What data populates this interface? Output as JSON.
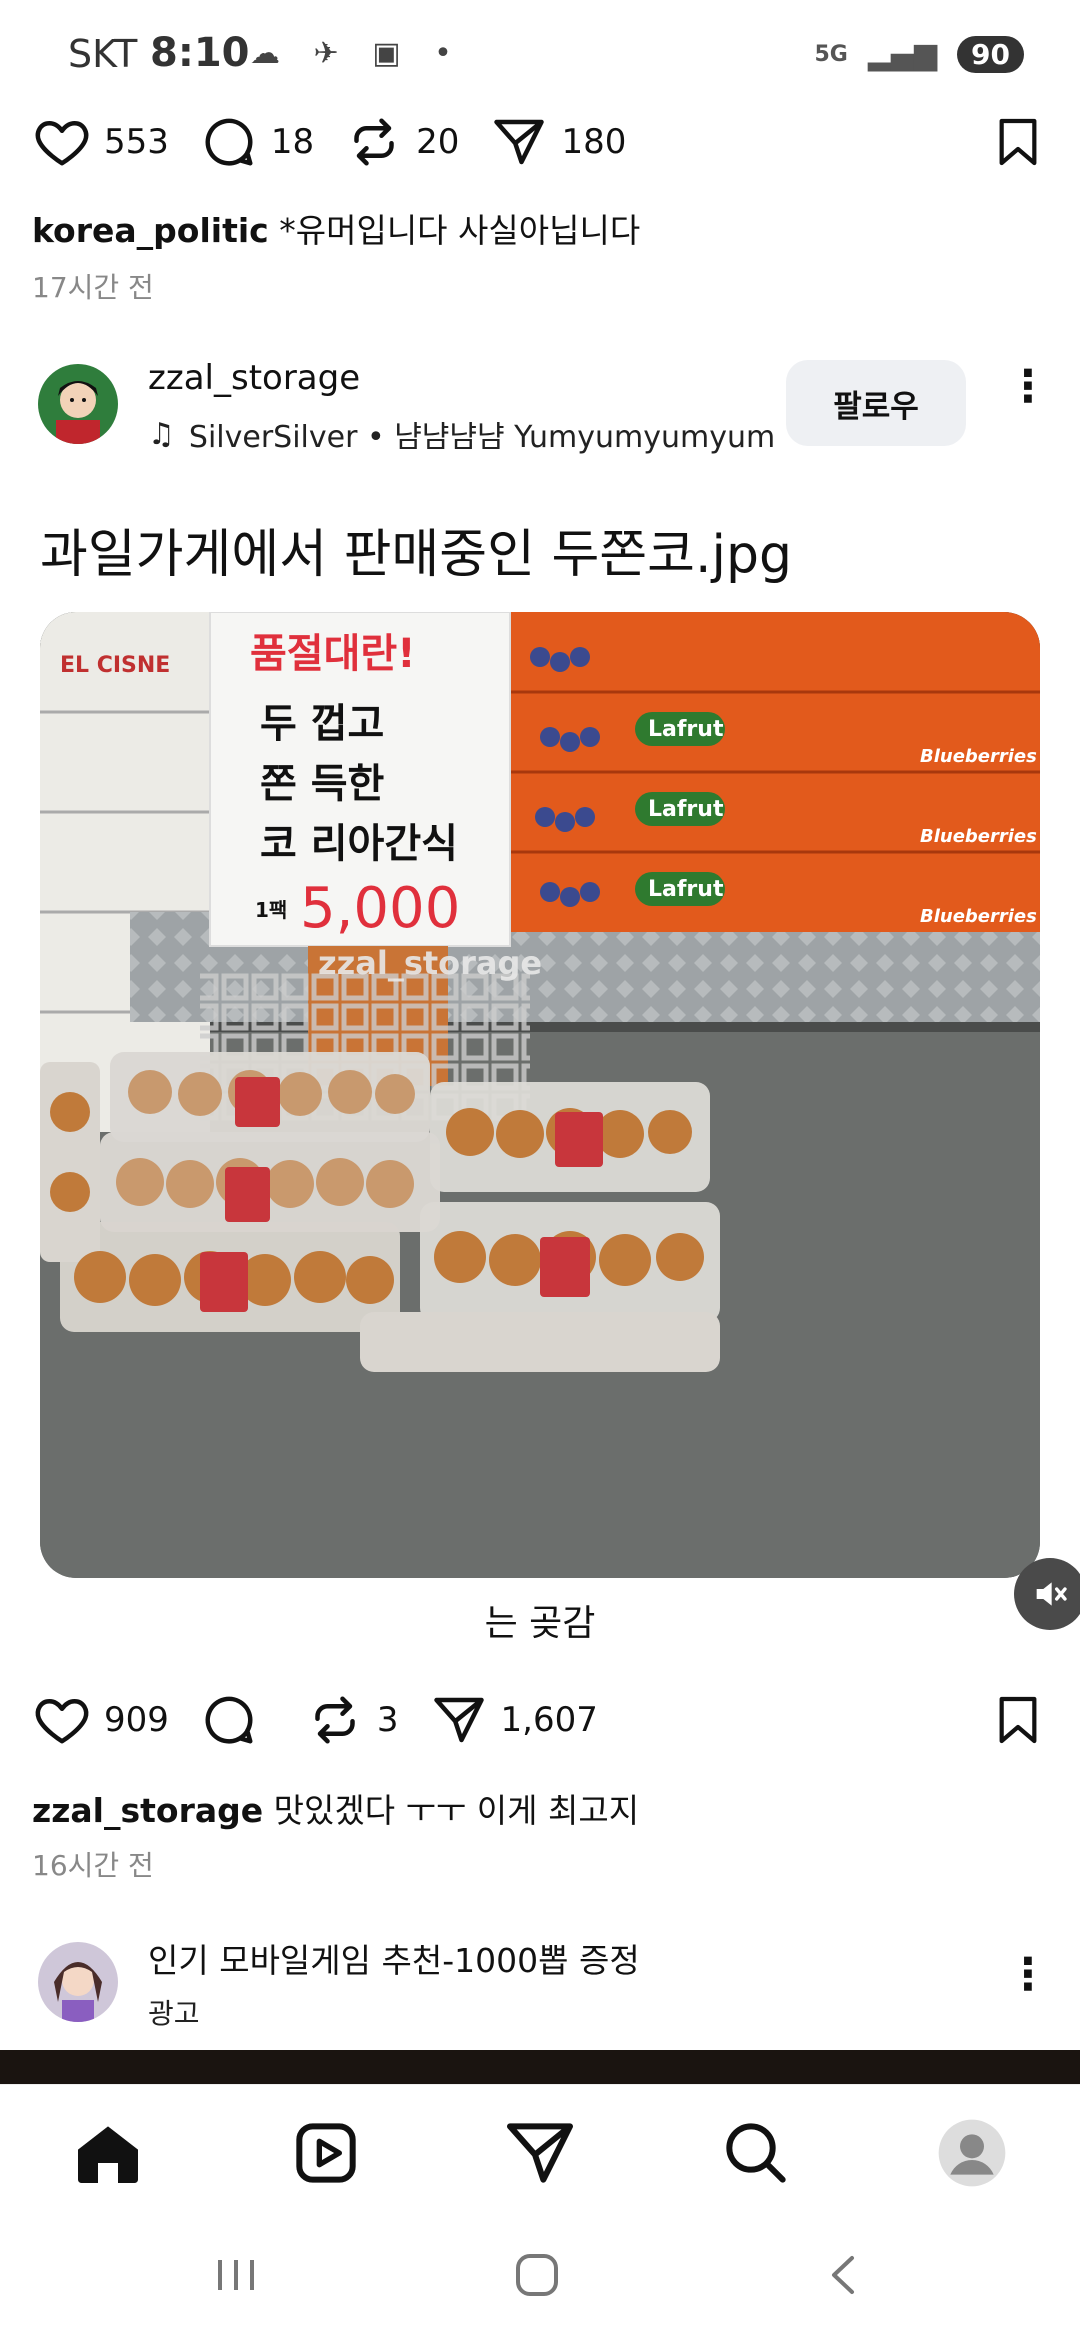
{
  "status_bar": {
    "carrier": "SKT",
    "time": "8:10",
    "network": "5G",
    "battery": "90"
  },
  "prev_post": {
    "likes": "553",
    "comments": "18",
    "reposts": "20",
    "shares": "180",
    "caption_user": "korea_politic",
    "caption_text": "*유머입니다 사실아닙니다",
    "time_ago": "17시간 전"
  },
  "post": {
    "username": "zzal_storage",
    "music": "SilverSilver • 냠냠냠냠 Yumyumyumyum",
    "follow_label": "팔로우",
    "title": "과일가게에서 판매중인 두쫀코.jpg",
    "photo": {
      "sign_heading": "품절대란!",
      "sign_lines": [
        "두 껍고",
        "쫀 득한",
        "코 리아간식"
      ],
      "sign_price_prefix": "1팩",
      "sign_price": "5,000",
      "watermark": "zzal_storage",
      "box_brand": "Lafrut",
      "box_product": "Blueberries",
      "box_brand_left": "EL CISNE"
    },
    "image_caption": "는 곶감",
    "likes": "909",
    "comments": "",
    "reposts": "3",
    "shares": "1,607",
    "caption_user": "zzal_storage",
    "caption_text": "맛있겠다 ㅜㅜ 이게 최고지",
    "time_ago": "16시간 전"
  },
  "ad": {
    "title": "인기 모바일게임 추천-1000뽑 증정",
    "label": "광고"
  },
  "icons": {
    "like": "heart-icon",
    "comment": "comment-icon",
    "repost": "repost-icon",
    "share": "send-icon",
    "bookmark": "bookmark-icon"
  }
}
